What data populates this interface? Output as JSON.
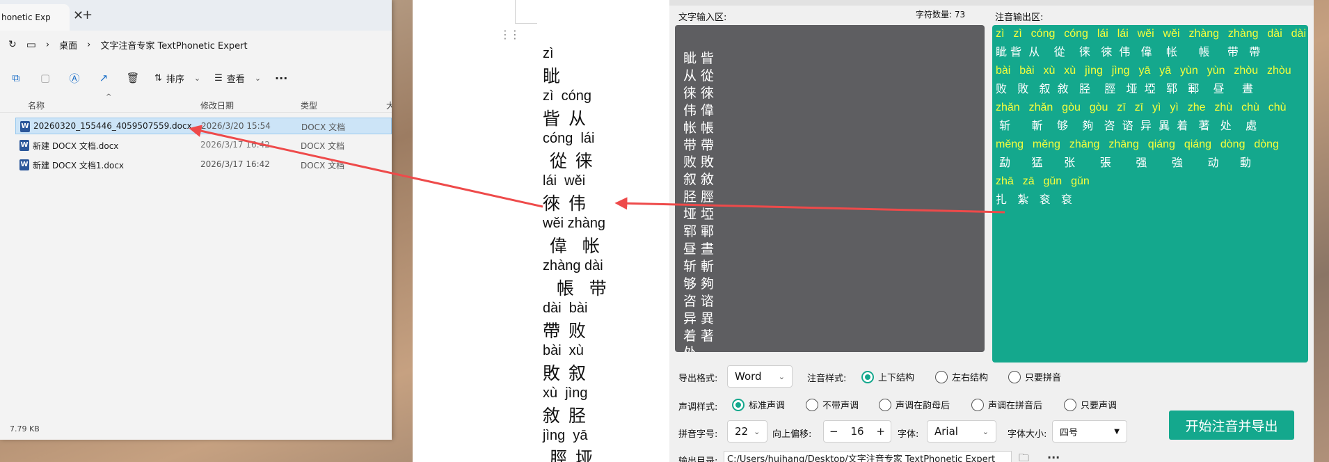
{
  "explorer": {
    "tab_title": "honetic Exp",
    "breadcrumb": [
      "桌面",
      "文字注音专家 TextPhonetic Expert"
    ],
    "toolbar": {
      "sort_label": "排序",
      "view_label": "查看"
    },
    "columns": [
      "名称",
      "修改日期",
      "类型",
      "大"
    ],
    "files": [
      {
        "name": "20260320_155446_4059507559.docx",
        "date": "2026/3/20 15:54",
        "type": "DOCX 文档"
      },
      {
        "name": "新建 DOCX 文档.docx",
        "date": "2026/3/17 16:42",
        "type": "DOCX 文档"
      },
      {
        "name": "新建 DOCX 文档1.docx",
        "date": "2026/3/17 16:42",
        "type": "DOCX 文档"
      }
    ],
    "status": "7.79 KB"
  },
  "document": {
    "lines": [
      {
        "py": "zì",
        "hz": ""
      },
      {
        "py": "",
        "hz": "眦"
      },
      {
        "py": "zì  cóng",
        "hz": ""
      },
      {
        "py": "",
        "hz": "眥 从"
      },
      {
        "py": "cóng  lái",
        "hz": ""
      },
      {
        "py": "",
        "hz": " 從 徕"
      },
      {
        "py": "lái  wěi",
        "hz": ""
      },
      {
        "py": "",
        "hz": "徠 伟"
      },
      {
        "py": "wěi zhàng",
        "hz": ""
      },
      {
        "py": "",
        "hz": " 偉  帐"
      },
      {
        "py": "zhàng dài",
        "hz": ""
      },
      {
        "py": "",
        "hz": "  帳  带"
      },
      {
        "py": "dài  bài",
        "hz": ""
      },
      {
        "py": "",
        "hz": "帶 败"
      },
      {
        "py": "bài  xù",
        "hz": ""
      },
      {
        "py": "",
        "hz": "敗 叙"
      },
      {
        "py": "xù  jìng",
        "hz": ""
      },
      {
        "py": "",
        "hz": "敘 胫"
      },
      {
        "py": "jìng  yā",
        "hz": ""
      },
      {
        "py": "",
        "hz": " 脛 垭"
      }
    ]
  },
  "app": {
    "input_label": "文字输入区:",
    "char_count_label": "字符数量: 73",
    "output_label": "注音输出区:",
    "input_text": "眦眥从從徕徠伟偉帐帳带帶败敗叙敘胫脛垭埡郓鄆昼晝斩斬够夠咨谘异異着著处",
    "output_lines": [
      {
        "py": "zì  zì  cóng  cóng  lái  lái  wěi  wěi  zhàng  zhàng  dài  dài",
        "hz": "眦 眥  从    從    徕   徠  伟   偉    帐      帳     带   帶"
      },
      {
        "py": "bài  bài  xù  xù  jìng  jìng  yā  yā  yùn  yùn  zhòu  zhòu",
        "hz": "败   敗   叙  敘   胫    脛   垭  埡   郓   鄆    昼     晝"
      },
      {
        "py": "zhǎn  zhǎn  gòu  gòu  zī  zī  yì  yì  zhe  zhù  chù  chù",
        "hz": " 斩      斬    够    夠   咨  谘  异  異  着   著   处    處"
      },
      {
        "py": "měng  měng  zhāng  zhāng  qiáng  qiáng  dòng  dòng",
        "hz": " 勐      猛      张       張       强       強       动      動"
      },
      {
        "py": "zhā  zā  gǔn  gǔn",
        "hz": "扎   紮   衮   袞"
      }
    ],
    "export_format_label": "导出格式:",
    "export_format_value": "Word",
    "phonetic_style_label": "注音样式:",
    "phonetic_style_options": [
      "上下结构",
      "左右结构",
      "只要拼音"
    ],
    "tone_style_label": "声调样式:",
    "tone_style_options": [
      "标准声调",
      "不带声调",
      "声调在韵母后",
      "声调在拼音后",
      "只要声调"
    ],
    "pinyin_size_label": "拼音字号:",
    "pinyin_size_value": "22",
    "offset_label": "向上偏移:",
    "offset_minus": "−",
    "offset_value": "16",
    "offset_plus": "+",
    "font_label": "字体:",
    "font_value": "Arial",
    "font_size_label": "字体大小:",
    "font_size_value": "四号",
    "start_button": "开始注音并导出",
    "output_dir_label": "输出目录:",
    "output_dir_value": "C:/Users/huihang/Desktop/文字注音专家 TextPhonetic Expert"
  },
  "colors": {
    "accent": "#14a88d",
    "pinyin_yellow": "#f7ff3c",
    "input_bg": "#5e5e61",
    "arrow_red": "#ee4a4a"
  }
}
